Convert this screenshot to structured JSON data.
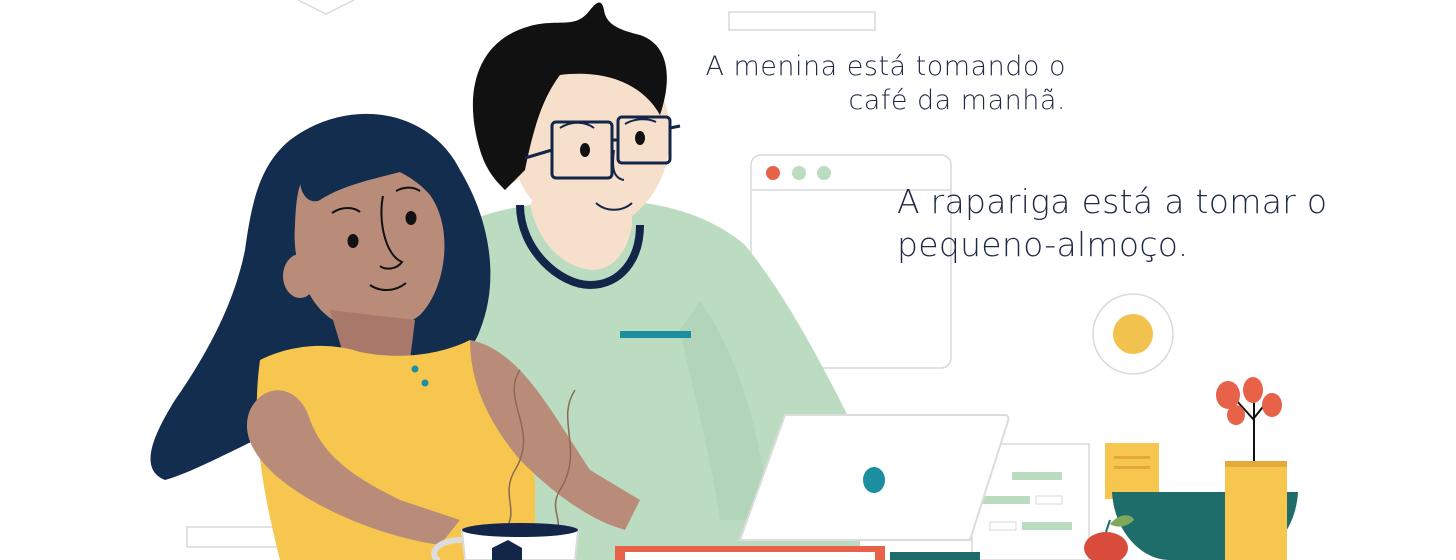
{
  "captions": {
    "brazilian": {
      "line1": "A menina está tomando o",
      "line2": "café da manhã."
    },
    "european": {
      "line1": "A rapariga está a tomar o",
      "line2": "pequeno-almoço."
    }
  },
  "colors": {
    "hair_woman": "#132d4e",
    "skin_woman": "#b88c78",
    "shirt_woman": "#f7c64e",
    "hair_man": "#111111",
    "skin_man": "#f6e0cc",
    "shirt_man": "#bcdcc2",
    "accent_teal": "#1d8ea1",
    "accent_red": "#e8624a",
    "outline": "#dcdcdc"
  },
  "icons": [
    "browser-window-icon",
    "coin-icon",
    "laptop-logo-icon",
    "mug-logo-icon",
    "plant-icon",
    "apple-icon"
  ]
}
